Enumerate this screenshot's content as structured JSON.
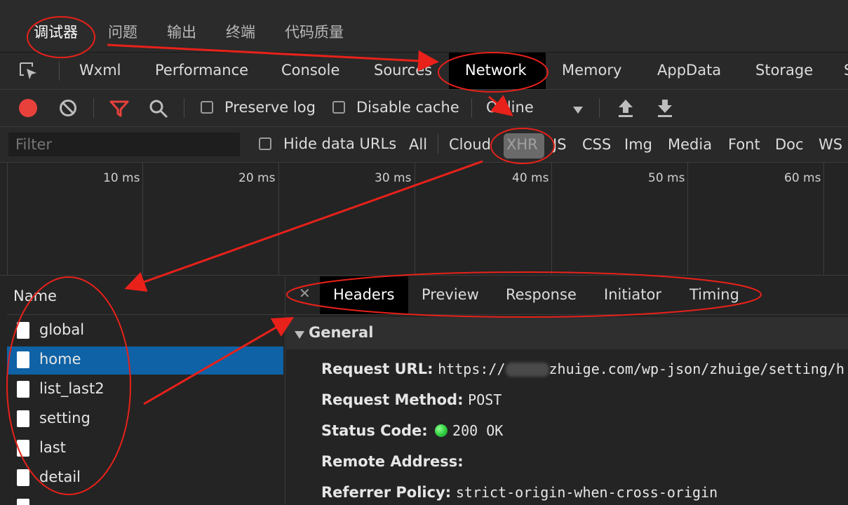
{
  "top_tabs": [
    "调试器",
    "问题",
    "输出",
    "终端",
    "代码质量"
  ],
  "panel_tabs": [
    "Wxml",
    "Performance",
    "Console",
    "Sources",
    "Network",
    "Memory",
    "AppData",
    "Storage",
    "S"
  ],
  "toolbar": {
    "preserve_log": "Preserve log",
    "disable_cache": "Disable cache",
    "throttle": "Online"
  },
  "filter": {
    "placeholder": "Filter",
    "hide_data_urls": "Hide data URLs",
    "types": [
      "All",
      "Cloud",
      "XHR",
      "JS",
      "CSS",
      "Img",
      "Media",
      "Font",
      "Doc",
      "WS"
    ]
  },
  "timeline": [
    "10 ms",
    "20 ms",
    "30 ms",
    "40 ms",
    "50 ms",
    "60 ms"
  ],
  "name_header": "Name",
  "requests": [
    "global",
    "home",
    "list_last2",
    "setting",
    "last",
    "detail"
  ],
  "selected_request": "home",
  "detail_tabs": [
    "Headers",
    "Preview",
    "Response",
    "Initiator",
    "Timing"
  ],
  "general": {
    "title": "General",
    "request_url_label": "Request URL:",
    "request_url_value": "https://",
    "request_url_value_rest": "zhuige.com/wp-json/zhuige/setting/h",
    "request_method_label": "Request Method:",
    "request_method_value": "POST",
    "status_code_label": "Status Code:",
    "status_code_value": "200 OK",
    "remote_address_label": "Remote Address:",
    "referrer_policy_label": "Referrer Policy:",
    "referrer_policy_value": "strict-origin-when-cross-origin"
  },
  "colors": {
    "record": "#e8413c",
    "filter_icon": "#e8413c",
    "selected_row": "#0e62a5",
    "status_ok": "#2ecc40",
    "annotation": "#e8211a"
  }
}
